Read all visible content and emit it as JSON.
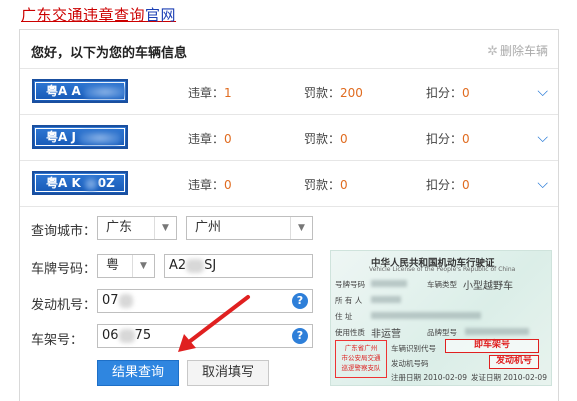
{
  "top_link": {
    "red": "广东交通违章查询",
    "blue": "官网"
  },
  "header": {
    "title": "您好，以下为您的车辆信息",
    "delete": "删除车辆"
  },
  "vehicles": [
    {
      "plate": "粤A A",
      "violations_label": "违章：",
      "violations": "1",
      "fine_label": "罚款：",
      "fine": "200",
      "points_label": "扣分：",
      "points": "0"
    },
    {
      "plate": "粤A J",
      "violations_label": "违章：",
      "violations": "0",
      "fine_label": "罚款：",
      "fine": "0",
      "points_label": "扣分：",
      "points": "0"
    },
    {
      "plate": "粤A K",
      "plate_suffix": "0Z",
      "violations_label": "违章：",
      "violations": "0",
      "fine_label": "罚款：",
      "fine": "0",
      "points_label": "扣分：",
      "points": "0"
    }
  ],
  "form": {
    "city_label": "查询城市：",
    "province": "广东",
    "city": "广州",
    "plate_label": "车牌号码：",
    "plate_prefix": "粤",
    "plate_number_a": "A2",
    "plate_number_b": "SJ",
    "engine_label": "发动机号：",
    "engine_value": "07",
    "vin_label": "车架号：",
    "vin_value_a": "06",
    "vin_value_b": "75",
    "help": "?",
    "submit": "结果查询",
    "cancel": "取消填写"
  },
  "license": {
    "title": "中华人民共和国机动车行驶证",
    "subtitle": "Vehicle License of the People's Republic of China",
    "plate_label": "号牌号码",
    "type_label": "车辆类型",
    "type_value": "小型越野车",
    "owner_label": "所 有 人",
    "address_label": "住 址",
    "usage_label": "使用性质",
    "usage_value": "非运营",
    "model_label": "品牌型号",
    "vin_label": "车辆识别代号",
    "vin_box": "即车架号",
    "engine_label": "发动机号码",
    "engine_box": "发动机号",
    "register_label": "注册日期",
    "register_date": "2010-02-09",
    "issue_label": "发证日期",
    "issue_date": "2010-02-09",
    "stamp_line1": "广东省广州",
    "stamp_line2": "市公安局交通",
    "stamp_line3": "巡逻警察支队"
  },
  "colors": {
    "accent": "#2f86e0",
    "value": "#e06b1f",
    "title_red": "#cc0000",
    "annotation_red": "#e02020"
  },
  "icons": {
    "gear": "gear-icon",
    "expand": "chevron-down-icon",
    "help": "help-icon",
    "annotation_arrow": "arrow-icon"
  }
}
